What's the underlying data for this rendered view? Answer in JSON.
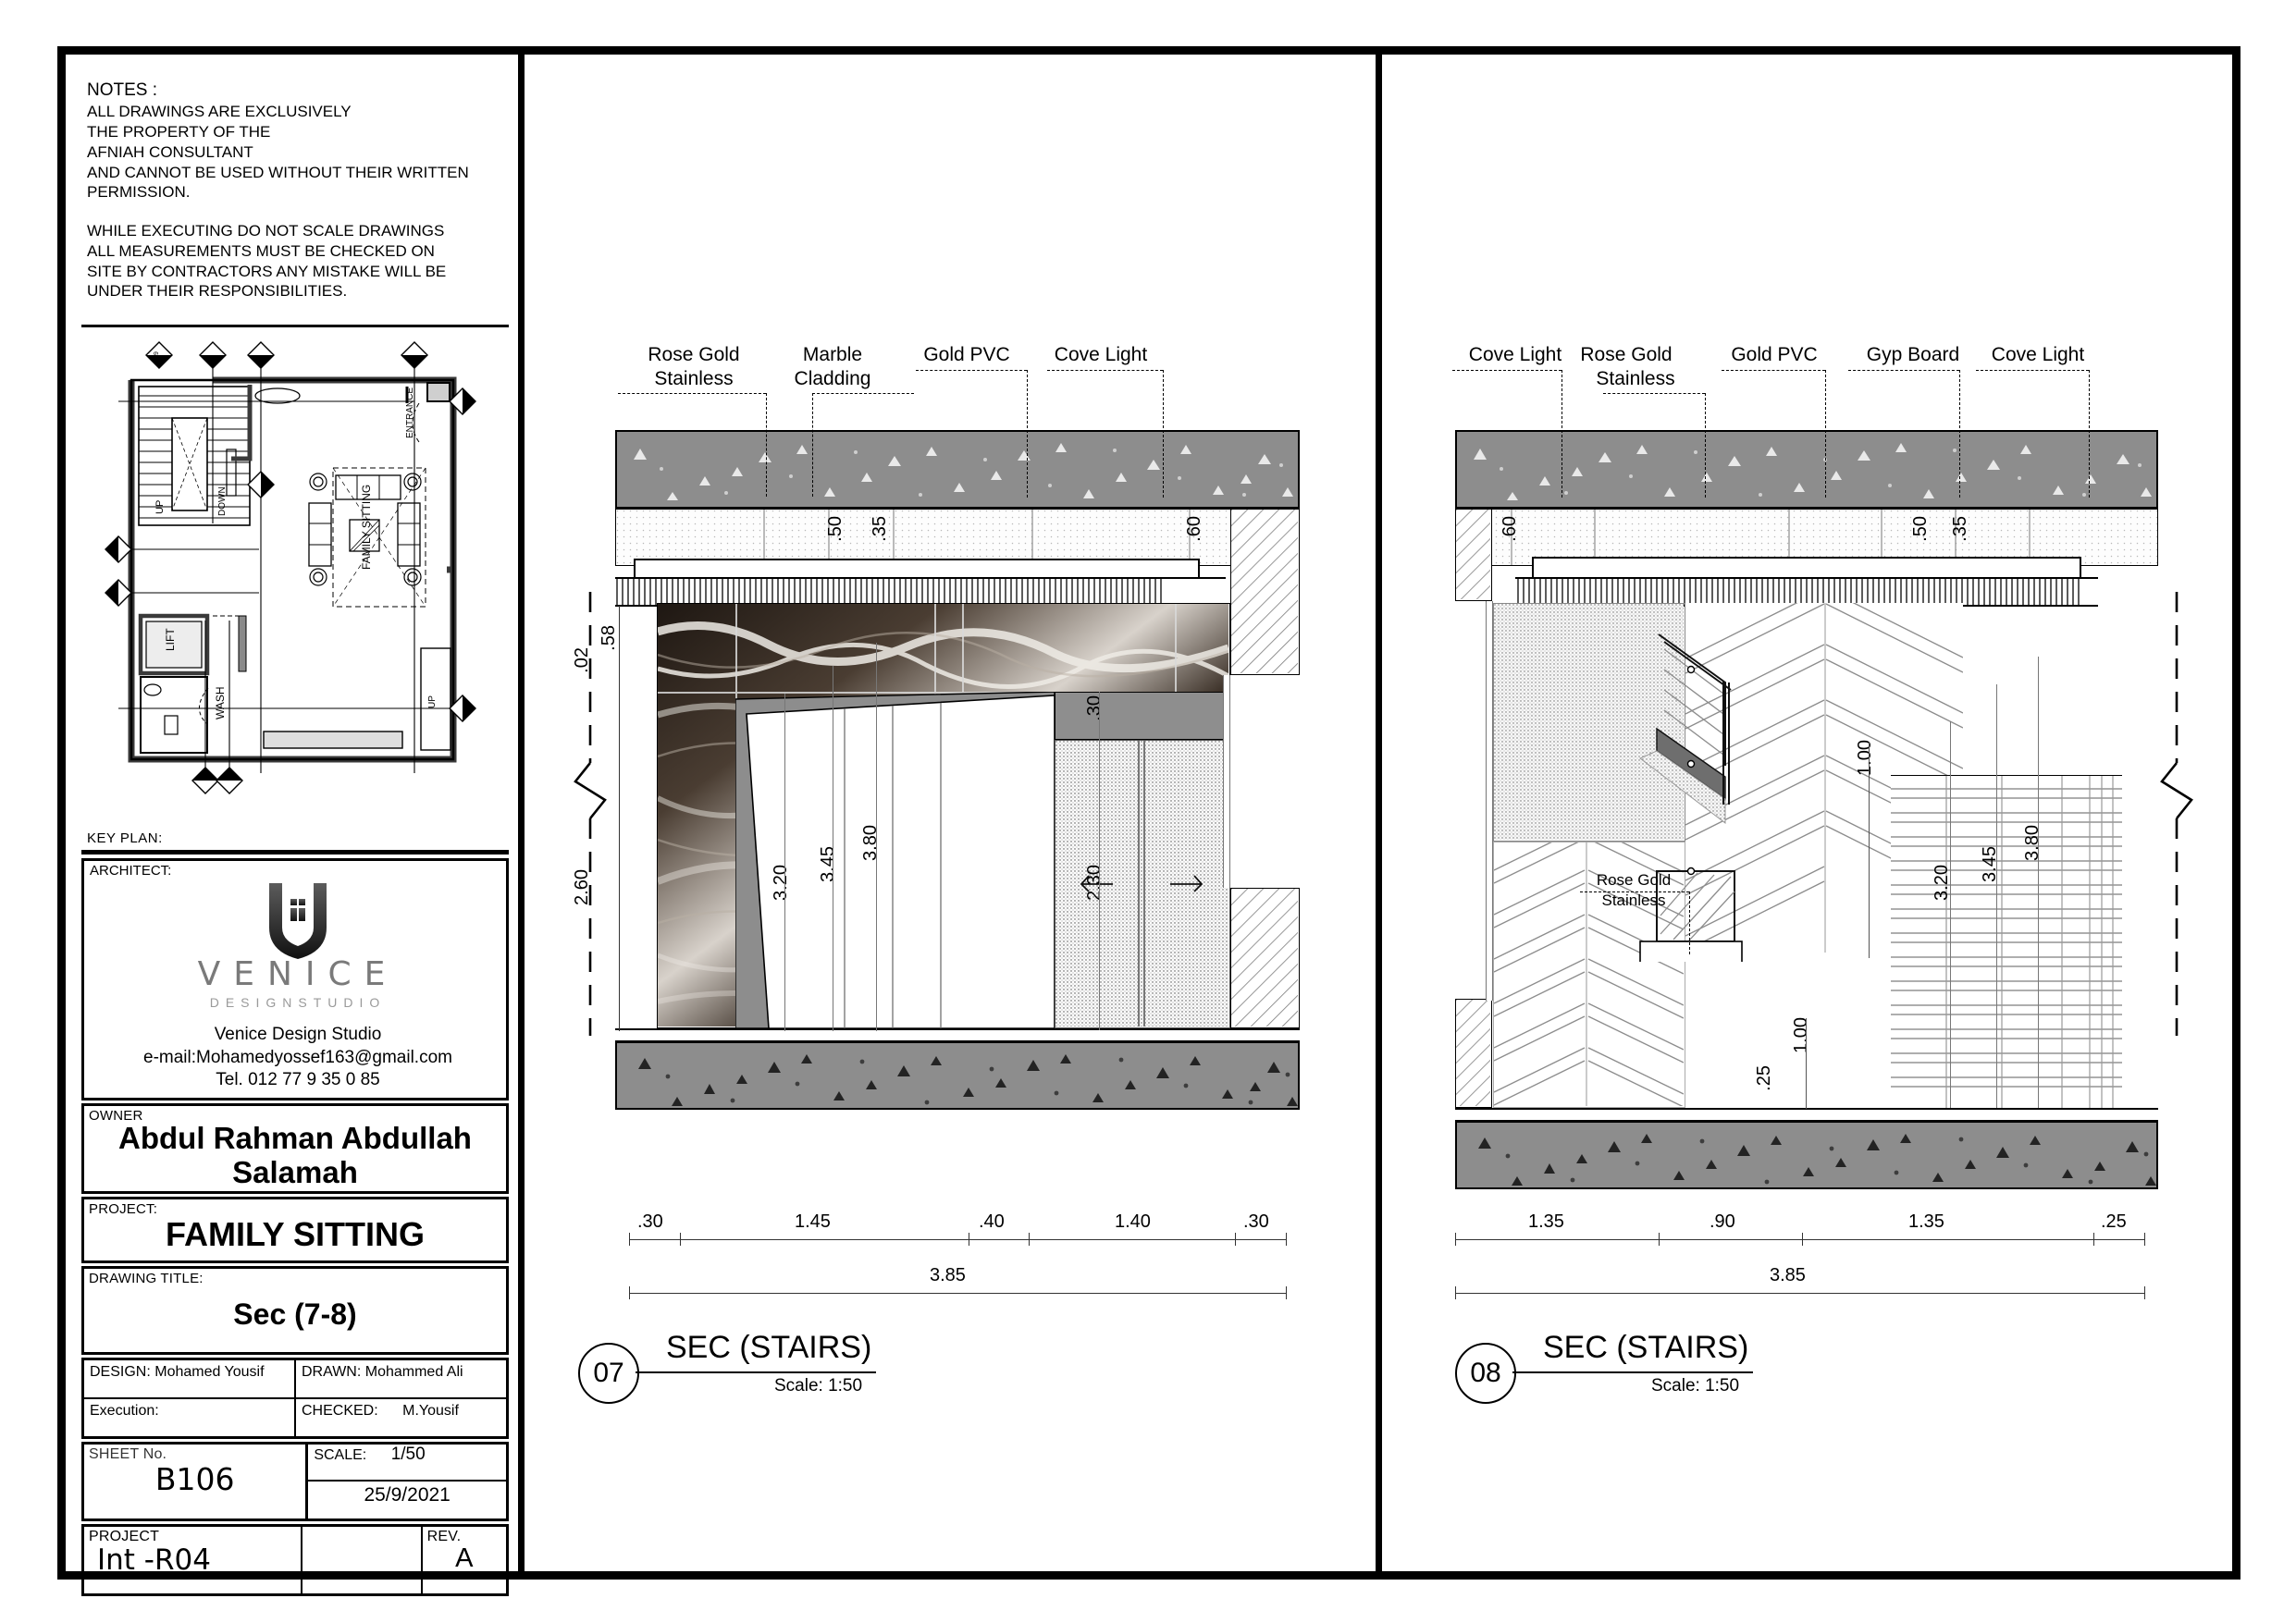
{
  "notes": {
    "heading": "NOTES :",
    "lines": [
      "ALL DRAWINGS ARE EXCLUSIVELY",
      "THE PROPERTY OF THE",
      "AFNIAH CONSULTANT",
      "AND CANNOT BE USED WITHOUT THEIR WRITTEN",
      "PERMISSION."
    ],
    "lines2": [
      "WHILE EXECUTING DO NOT SCALE DRAWINGS",
      "ALL MEASUREMENTS MUST BE CHECKED ON",
      "SITE BY CONTRACTORS ANY MISTAKE WILL BE",
      "UNDER THEIR RESPONSIBILITIES."
    ]
  },
  "keyplan": {
    "label": "KEY  PLAN:",
    "room_labels": [
      "UP",
      "DOWN",
      "LIFT",
      "WASH",
      "FAMILY SITTING",
      "ENTRANCE",
      "UP"
    ],
    "markers": [
      "09",
      "01",
      "01",
      "02",
      "02",
      "08",
      "08",
      "02",
      "07",
      "09",
      "08"
    ]
  },
  "architect": {
    "label": "ARCHITECT:",
    "logo_word": "VENICE",
    "logo_sub": "DESIGNSTUDIO",
    "name": "Venice Design Studio",
    "email": "e-mail:Mohamedyossef163@gmail.com",
    "tel": "Tel. 012 77 9 35 0 85"
  },
  "owner": {
    "label": "OWNER",
    "value": "Abdul Rahman Abdullah Salamah"
  },
  "project": {
    "label": "PROJECT:",
    "value": "FAMILY SITTING"
  },
  "drawing_title": {
    "label": "DRAWING  TITLE:",
    "value": "Sec (7-8)"
  },
  "credits": {
    "design_label": "DESIGN:",
    "design_value": "Mohamed Yousif",
    "drawn_label": "DRAWN:",
    "drawn_value": "Mohammed Ali",
    "execution_label": "Execution:",
    "execution_value": "",
    "checked_label": "CHECKED:",
    "checked_value": "M.Yousif"
  },
  "sheet": {
    "sheet_no_label": "SHEET  No.",
    "sheet_no_value": "B106",
    "scale_label": "SCALE:",
    "scale_value": "1/50",
    "date_value": "25/9/2021"
  },
  "footer": {
    "project_label": "PROJECT",
    "project_value": "Int -R04",
    "blank_value": "",
    "rev_label": "REV.",
    "rev_value": "A"
  },
  "section_left": {
    "number": "07",
    "title": "SEC (STAIRS)",
    "scale": "Scale: 1:50",
    "annotations": [
      "Rose Gold Stainless",
      "Marble Cladding",
      "Gold PVC",
      "Cove Light"
    ],
    "annotation_parts": [
      {
        "l1": "Rose Gold",
        "l2": "Stainless"
      },
      {
        "l1": "Marble",
        "l2": "Cladding"
      },
      {
        "l1": "Gold PVC",
        "l2": ""
      },
      {
        "l1": "Cove Light",
        "l2": ""
      }
    ],
    "vertical_dims": [
      ".35",
      ".50",
      ".60",
      ".58",
      ".02",
      "2.60",
      "3.20",
      "3.45",
      "3.80",
      ".30",
      "2.30"
    ],
    "horizontal_dims": [
      ".30",
      "1.45",
      ".40",
      "1.40",
      ".30"
    ],
    "overall_dim": "3.85"
  },
  "section_right": {
    "number": "08",
    "title": "SEC (STAIRS)",
    "scale": "Scale: 1:50",
    "annotations": [
      "Cove Light",
      "Rose Gold Stainless",
      "Gold PVC",
      "Gyp Board",
      "Cove Light"
    ],
    "annotation_parts": [
      {
        "l1": "Cove Light",
        "l2": ""
      },
      {
        "l1": "Rose Gold",
        "l2": "Stainless"
      },
      {
        "l1": "Gold PVC",
        "l2": ""
      },
      {
        "l1": "Gyp Board",
        "l2": ""
      },
      {
        "l1": "Cove Light",
        "l2": ""
      }
    ],
    "inner_annotation": {
      "l1": "Rose Gold",
      "l2": "Stainless"
    },
    "vertical_dims": [
      ".60",
      ".50",
      ".35",
      "1.00",
      "3.20",
      "3.45",
      "3.80",
      "1.00",
      ".25"
    ],
    "horizontal_dims": [
      "1.35",
      ".90",
      "1.35",
      ".25"
    ],
    "overall_dim": "3.85"
  },
  "colors": {
    "slab_fill": "#8d8d8d",
    "ink": "#000000",
    "marble_dark": "#2a2119",
    "logo_grey": "#7a7a7a"
  }
}
